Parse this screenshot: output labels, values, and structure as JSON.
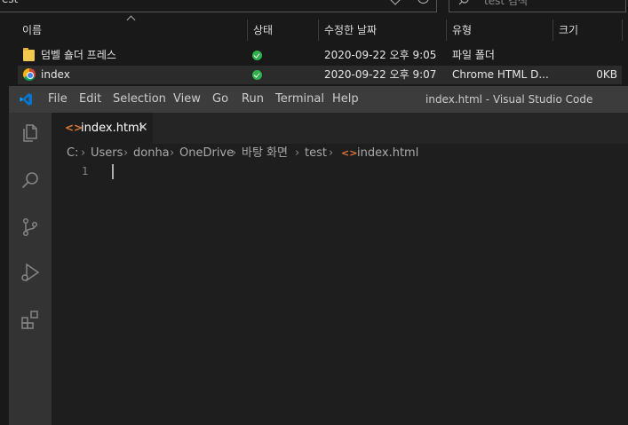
{
  "explorer": {
    "address_text": "est",
    "search_placeholder": "test 검색",
    "columns": [
      "이름",
      "상태",
      "수정한 날짜",
      "유형",
      "크기"
    ],
    "rows": [
      {
        "name": "덤벨 숄더 프레스",
        "date": "2020-09-22 오후 9:05",
        "type": "파일 폴더",
        "size": "",
        "icon": "folder-icon"
      },
      {
        "name": "index",
        "date": "2020-09-22 오후 9:07",
        "type": "Chrome HTML D...",
        "size": "0KB",
        "icon": "chrome-icon"
      }
    ],
    "sync_color": "#2db14a"
  },
  "vscode": {
    "menu": [
      "File",
      "Edit",
      "Selection",
      "View",
      "Go",
      "Run",
      "Terminal",
      "Help"
    ],
    "window_title": "index.html - Visual Studio Code",
    "tab": {
      "label": "index.html",
      "close": "✕",
      "icon": "<>"
    },
    "breadcrumb": [
      "C:",
      "Users",
      "donha",
      "OneDrive",
      "바탕 화면",
      "test",
      "index.html"
    ],
    "line_numbers": [
      "1"
    ],
    "accent": "#007acc"
  }
}
